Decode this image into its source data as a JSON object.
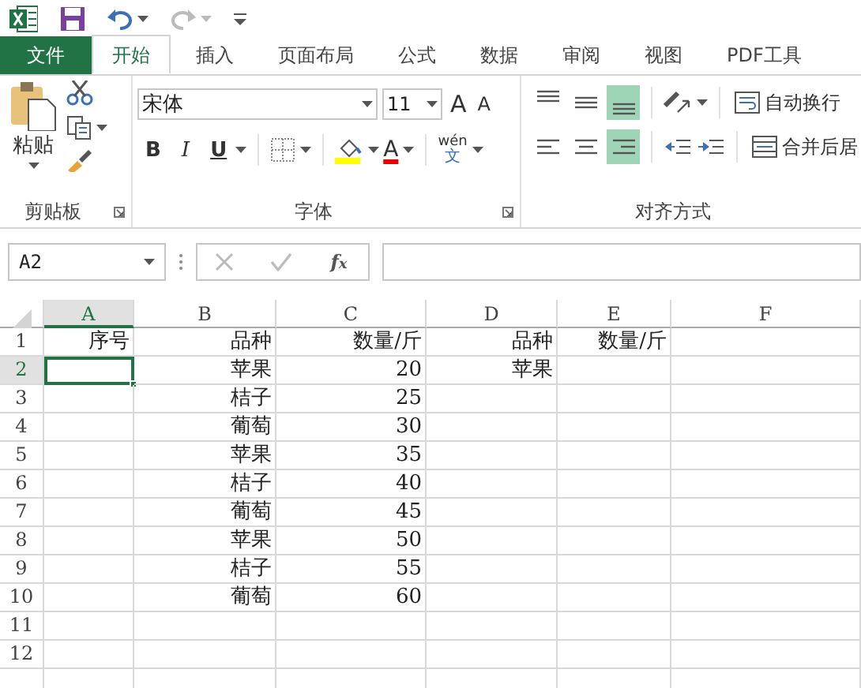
{
  "tabs": [
    {
      "label": "文件",
      "kind": "file",
      "selected": false
    },
    {
      "label": "开始",
      "kind": "tab",
      "selected": true
    },
    {
      "label": "插入",
      "kind": "tab",
      "selected": false
    },
    {
      "label": "页面布局",
      "kind": "tab",
      "selected": false
    },
    {
      "label": "公式",
      "kind": "tab",
      "selected": false
    },
    {
      "label": "数据",
      "kind": "tab",
      "selected": false
    },
    {
      "label": "审阅",
      "kind": "tab",
      "selected": false
    },
    {
      "label": "视图",
      "kind": "tab",
      "selected": false
    },
    {
      "label": "PDF工具",
      "kind": "tab",
      "selected": false
    }
  ],
  "clipboard": {
    "paste_label": "粘贴",
    "group_label": "剪贴板"
  },
  "font": {
    "font_name": "宋体",
    "font_size": "11",
    "grow": "A",
    "shrink": "A",
    "bold": "B",
    "italic": "I",
    "underline": "U",
    "font_color": "A",
    "phonetic_top": "wén",
    "phonetic_bottom": "文",
    "group_label": "字体"
  },
  "alignment": {
    "vertical": [
      {
        "selected": false
      },
      {
        "selected": false
      },
      {
        "selected": true
      }
    ],
    "horizontal": [
      {
        "selected": false
      },
      {
        "selected": false
      },
      {
        "selected": true
      }
    ],
    "wrap_text": "自动换行",
    "merge": "合并后居",
    "group_label": "对齐方式"
  },
  "formula_bar": {
    "name_box": "A2",
    "fx": "f$_{x}$"
  },
  "sheet": {
    "columns": [
      {
        "label": "A",
        "selected": true
      },
      {
        "label": "B",
        "selected": false
      },
      {
        "label": "C",
        "selected": false
      },
      {
        "label": "D",
        "selected": false
      },
      {
        "label": "E",
        "selected": false
      },
      {
        "label": "F",
        "selected": false
      }
    ],
    "rows": [
      {
        "label": "1",
        "selected": false,
        "cells": [
          "序号",
          "品种",
          "数量/斤",
          "品种",
          "数量/斤",
          null
        ]
      },
      {
        "label": "2",
        "selected": true,
        "cells": [
          null,
          "苹果",
          "20",
          "苹果",
          null,
          null
        ]
      },
      {
        "label": "3",
        "selected": false,
        "cells": [
          null,
          "桔子",
          "25",
          null,
          null,
          null
        ]
      },
      {
        "label": "4",
        "selected": false,
        "cells": [
          null,
          "葡萄",
          "30",
          null,
          null,
          null
        ]
      },
      {
        "label": "5",
        "selected": false,
        "cells": [
          null,
          "苹果",
          "35",
          null,
          null,
          null
        ]
      },
      {
        "label": "6",
        "selected": false,
        "cells": [
          null,
          "桔子",
          "40",
          null,
          null,
          null
        ]
      },
      {
        "label": "7",
        "selected": false,
        "cells": [
          null,
          "葡萄",
          "45",
          null,
          null,
          null
        ]
      },
      {
        "label": "8",
        "selected": false,
        "cells": [
          null,
          "苹果",
          "50",
          null,
          null,
          null
        ]
      },
      {
        "label": "9",
        "selected": false,
        "cells": [
          null,
          "桔子",
          "55",
          null,
          null,
          null
        ]
      },
      {
        "label": "10",
        "selected": false,
        "cells": [
          null,
          "葡萄",
          "60",
          null,
          null,
          null
        ]
      },
      {
        "label": "11",
        "selected": false,
        "cells": [
          null,
          null,
          null,
          null,
          null,
          null
        ]
      },
      {
        "label": "12",
        "selected": false,
        "cells": [
          null,
          null,
          null,
          null,
          null,
          null
        ]
      }
    ]
  }
}
